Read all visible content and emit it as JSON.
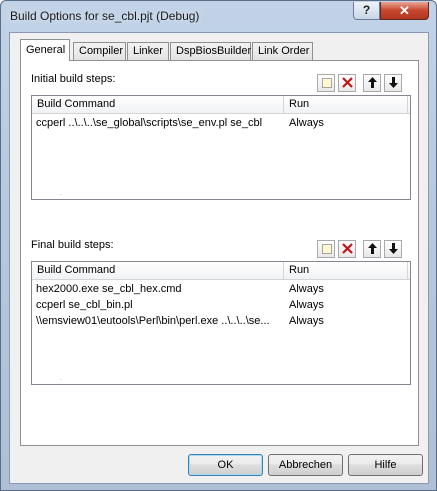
{
  "window": {
    "title": "Build Options for se_cbl.pjt (Debug)",
    "help_label": "?",
    "close_label": "✕"
  },
  "tabs": [
    {
      "label": "General"
    },
    {
      "label": "Compiler"
    },
    {
      "label": "Linker"
    },
    {
      "label": "DspBiosBuilder"
    },
    {
      "label": "Link Order"
    }
  ],
  "initial": {
    "label": "Initial build steps:",
    "columns": [
      "Build Command",
      "Run"
    ],
    "rows": [
      {
        "command": "ccperl ..\\..\\..\\se_global\\scripts\\se_env.pl se_cbl",
        "run": "Always"
      }
    ]
  },
  "final": {
    "label": "Final build steps:",
    "columns": [
      "Build Command",
      "Run"
    ],
    "rows": [
      {
        "command": "hex2000.exe se_cbl_hex.cmd",
        "run": "Always"
      },
      {
        "command": "ccperl se_cbl_bin.pl",
        "run": "Always"
      },
      {
        "command": "\\\\emsview01\\eutools\\Perl\\bin\\perl.exe ..\\..\\..\\se...",
        "run": "Always"
      }
    ]
  },
  "buttons": {
    "ok": "OK",
    "cancel": "Abbrechen",
    "help": "Hilfe"
  },
  "icons": [
    "new-item-icon",
    "delete-icon",
    "move-up-icon",
    "move-down-icon"
  ],
  "colors": {
    "delete": "#c0161a",
    "close_button": "#c7462e"
  }
}
